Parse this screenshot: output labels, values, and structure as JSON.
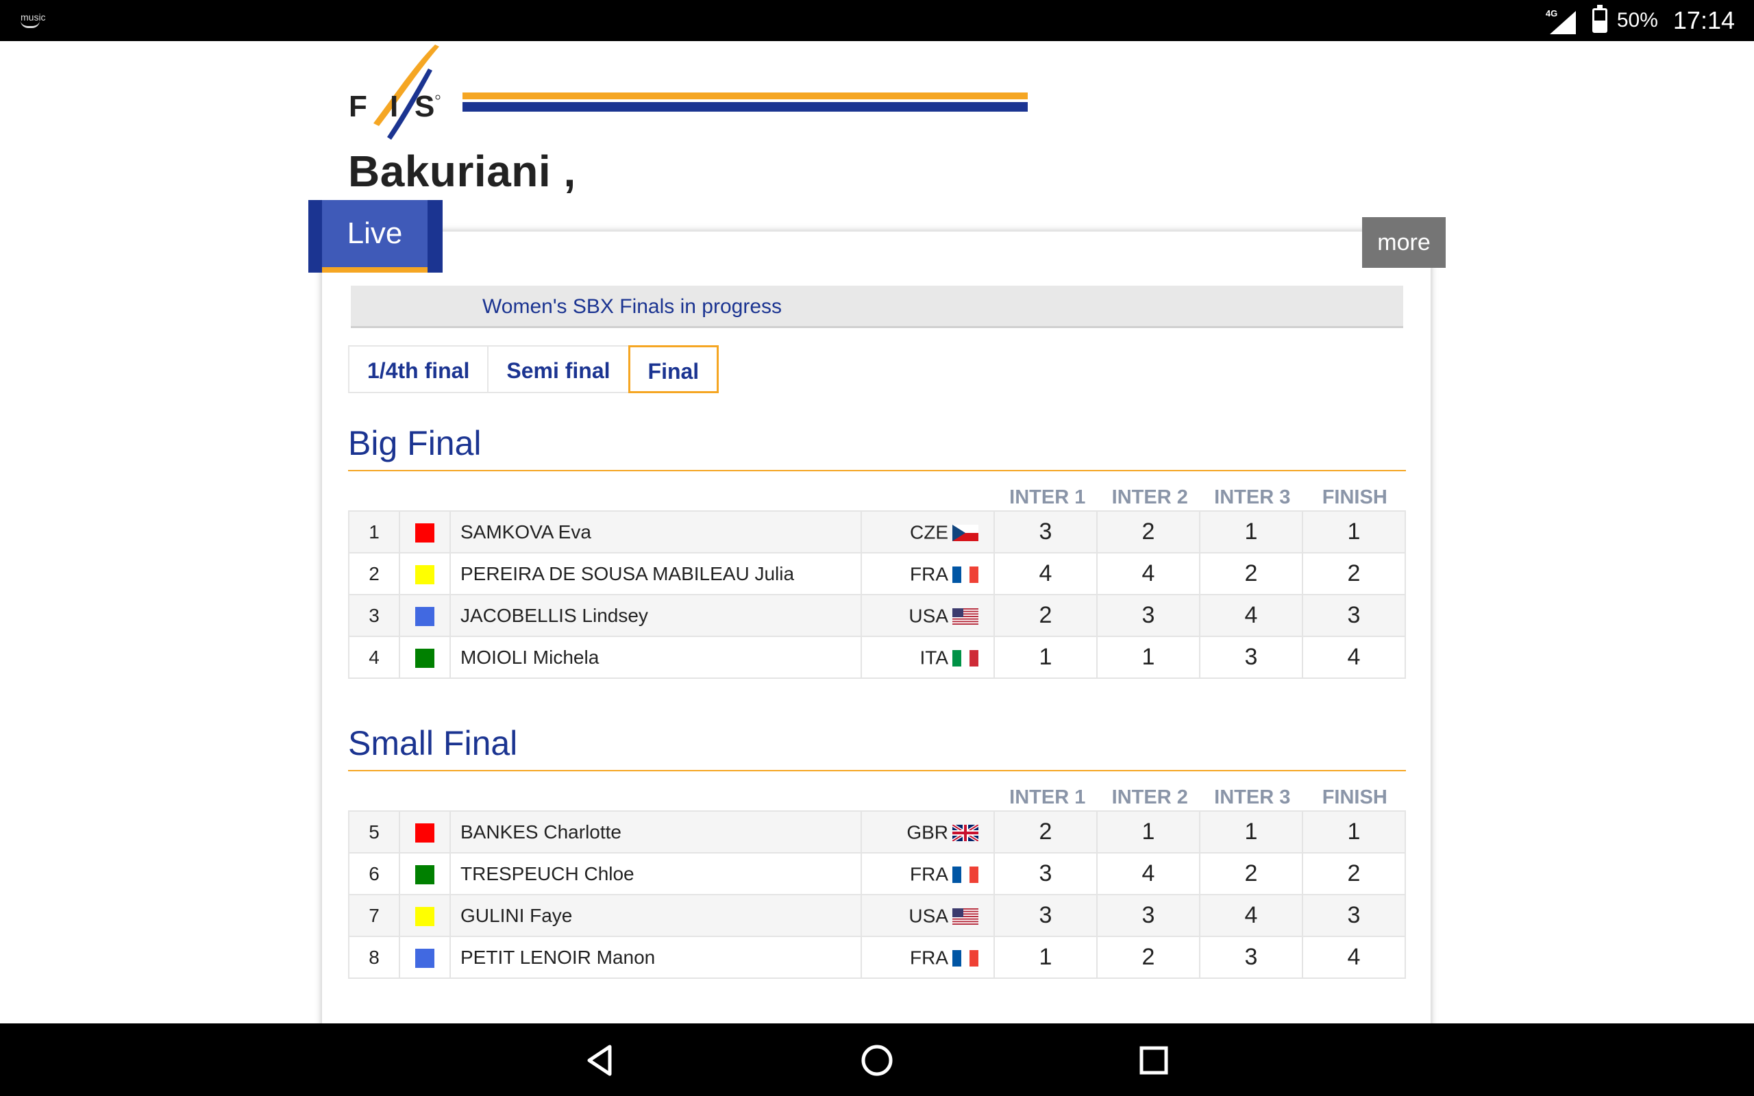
{
  "status_bar": {
    "app_label": "music",
    "network": "4G",
    "battery_percent_label": "50%",
    "battery_level": 0.5,
    "time": "17:14"
  },
  "header": {
    "logo_text": "FIS",
    "title": "Bakuriani ,"
  },
  "live": {
    "tab_label": "Live",
    "more_label": "more",
    "info_text": "Women's SBX Finals in progress"
  },
  "tabs": [
    {
      "label": "1/4th final",
      "active": false
    },
    {
      "label": "Semi final",
      "active": false
    },
    {
      "label": "Final",
      "active": true
    }
  ],
  "columns": [
    "INTER 1",
    "INTER 2",
    "INTER 3",
    "FINISH"
  ],
  "colors": {
    "fis_blue": "#1b3491",
    "fis_orange": "#f5a623",
    "bib_red": "#ff0000",
    "bib_yellow": "#ffff00",
    "bib_blue": "#4169e1",
    "bib_green": "#008000"
  },
  "big_final": {
    "title": "Big Final",
    "rows": [
      {
        "rank": "1",
        "bib_color": "#ff0000",
        "name": "SAMKOVA Eva",
        "nation": "CZE",
        "flag": "cze",
        "inter1": "3",
        "inter2": "2",
        "inter3": "1",
        "finish": "1"
      },
      {
        "rank": "2",
        "bib_color": "#ffff00",
        "name": "PEREIRA DE SOUSA MABILEAU Julia",
        "nation": "FRA",
        "flag": "fra",
        "inter1": "4",
        "inter2": "4",
        "inter3": "2",
        "finish": "2"
      },
      {
        "rank": "3",
        "bib_color": "#4169e1",
        "name": "JACOBELLIS Lindsey",
        "nation": "USA",
        "flag": "usa",
        "inter1": "2",
        "inter2": "3",
        "inter3": "4",
        "finish": "3"
      },
      {
        "rank": "4",
        "bib_color": "#008000",
        "name": "MOIOLI Michela",
        "nation": "ITA",
        "flag": "ita",
        "inter1": "1",
        "inter2": "1",
        "inter3": "3",
        "finish": "4"
      }
    ]
  },
  "small_final": {
    "title": "Small Final",
    "rows": [
      {
        "rank": "5",
        "bib_color": "#ff0000",
        "name": "BANKES Charlotte",
        "nation": "GBR",
        "flag": "gbr",
        "inter1": "2",
        "inter2": "1",
        "inter3": "1",
        "finish": "1"
      },
      {
        "rank": "6",
        "bib_color": "#008000",
        "name": "TRESPEUCH Chloe",
        "nation": "FRA",
        "flag": "fra",
        "inter1": "3",
        "inter2": "4",
        "inter3": "2",
        "finish": "2"
      },
      {
        "rank": "7",
        "bib_color": "#ffff00",
        "name": "GULINI Faye",
        "nation": "USA",
        "flag": "usa",
        "inter1": "3",
        "inter2": "3",
        "inter3": "4",
        "finish": "3"
      },
      {
        "rank": "8",
        "bib_color": "#4169e1",
        "name": "PETIT LENOIR Manon",
        "nation": "FRA",
        "flag": "fra",
        "inter1": "1",
        "inter2": "2",
        "inter3": "3",
        "finish": "4"
      }
    ]
  },
  "nav_bar": {
    "back": "back-icon",
    "home": "home-icon",
    "recent": "recent-apps-icon"
  }
}
